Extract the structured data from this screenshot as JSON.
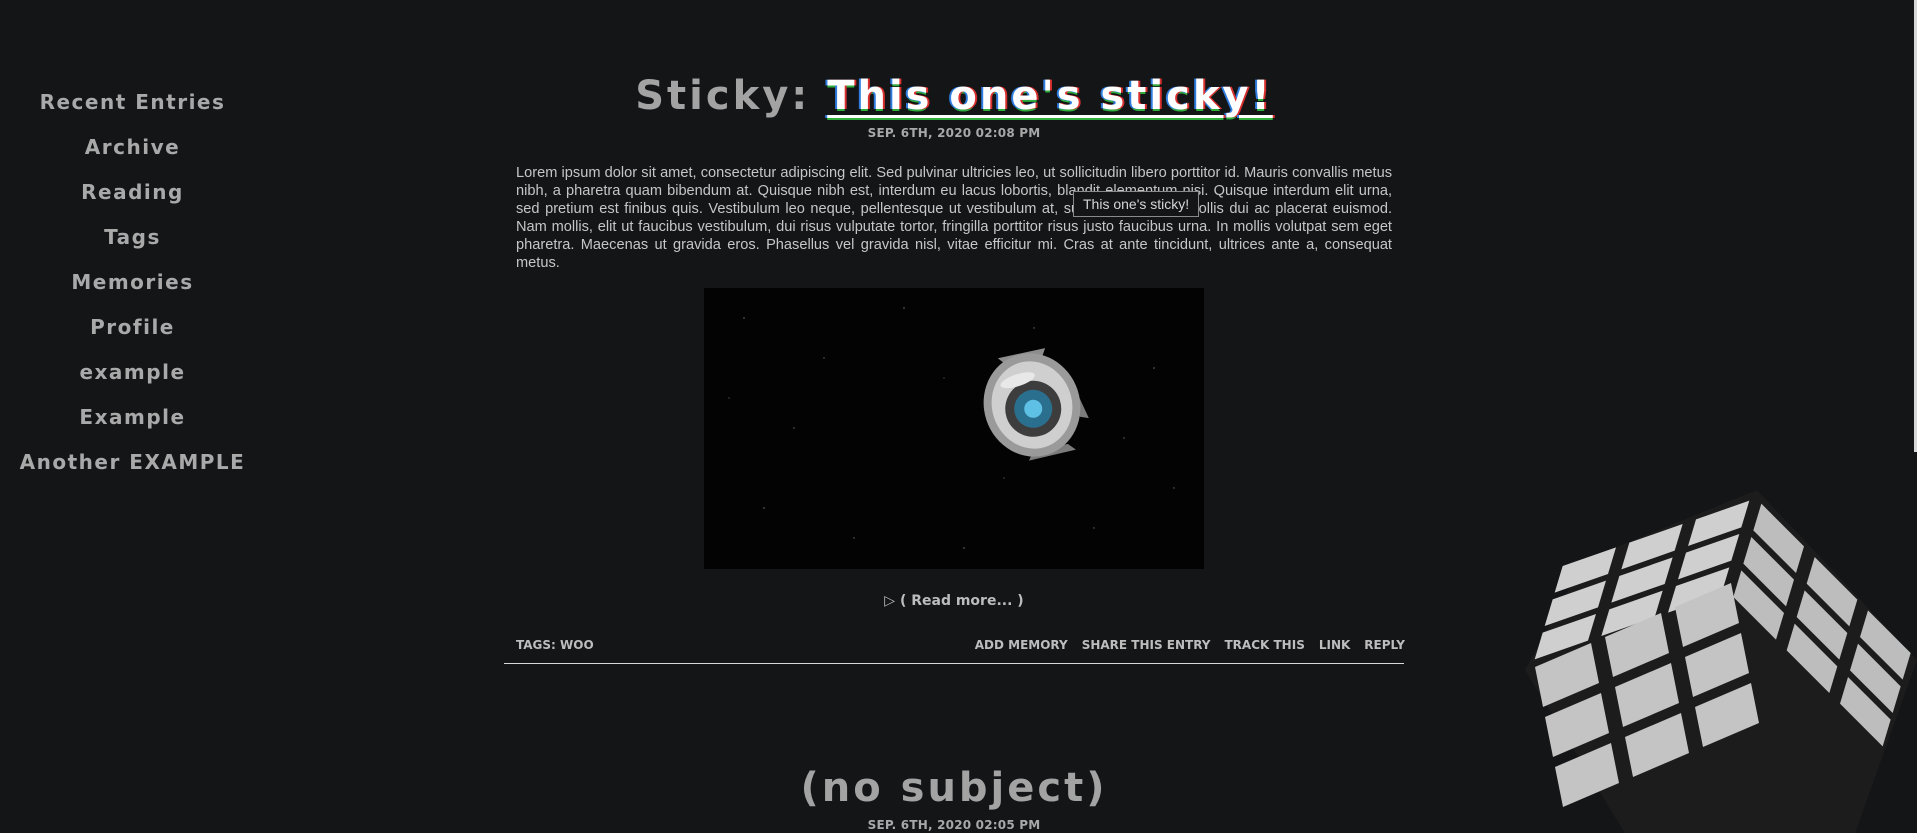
{
  "sidebar": {
    "items": [
      {
        "label": "Recent Entries"
      },
      {
        "label": "Archive"
      },
      {
        "label": "Reading"
      },
      {
        "label": "Tags"
      },
      {
        "label": "Memories"
      },
      {
        "label": "Profile"
      },
      {
        "label": "example"
      },
      {
        "label": "Example"
      },
      {
        "label": "Another EXAMPLE"
      }
    ]
  },
  "entries": [
    {
      "prefix": "Sticky:",
      "title": "This one's sticky!",
      "tooltip": "This one's sticky!",
      "date": "SEP. 6TH, 2020 02:08 PM",
      "body": "Lorem ipsum dolor sit amet, consectetur adipiscing elit. Sed pulvinar ultricies leo, ut sollicitudin libero porttitor id. Mauris convallis metus nibh, a pharetra quam bibendum at. Quisque nibh est, interdum eu lacus lobortis, blandit elementum nisi. Quisque interdum elit urna, sed pretium est finibus quis. Vestibulum leo neque, pellentesque ut vestibulum at, suscipit at orci. In mollis dui ac placerat euismod. Nam mollis, elit ut faucibus vestibulum, dui risus vulputate tortor, fringilla porttitor risus justo faucibus urna. In mollis volutpat sem eget pharetra. Maecenas ut gravida eros. Phasellus vel gravida nisl, vitae efficitur mi. Cras at ante tincidunt, ultrices ante a, consequat metus.",
      "read_more": "( Read more... )",
      "tags": "TAGS: WOO",
      "actions": {
        "add_memory": "ADD MEMORY",
        "share": "SHARE THIS ENTRY",
        "track": "TRACK THIS",
        "link": "LINK",
        "reply": "REPLY"
      }
    },
    {
      "title": "(no subject)",
      "date": "SEP. 6TH, 2020 02:05 PM"
    }
  ],
  "colors": {
    "background": "#131517",
    "title_red": "#d8302f",
    "title_blue": "#2f7de0",
    "title_green": "#2fae3c"
  },
  "icons": {
    "read_more": "triangle-right-icon",
    "decoration": "rubiks-cube-icon",
    "media": "space-core-image"
  }
}
